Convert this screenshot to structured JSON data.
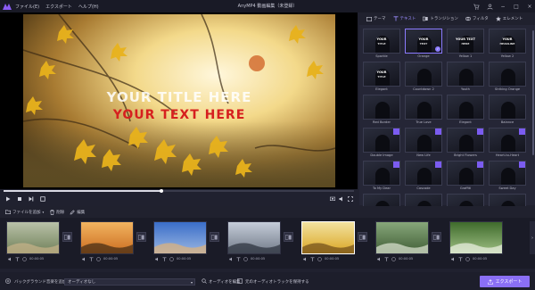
{
  "app": {
    "title": "AnyMP4 動画編集（未登録）",
    "menu": [
      "ファイル(E)",
      "エクスポート",
      "ヘルプ(H)"
    ],
    "accent_color": "#8b7bff"
  },
  "window_controls": {
    "cart": "cart-icon",
    "user": "user-icon",
    "minimize": "−",
    "maximize": "□",
    "close": "×"
  },
  "preview": {
    "title_line1": "YOUR TITLE HERE",
    "title_line2": "YOUR TEXT HERE",
    "progress": 0.45,
    "timecode": "00:00:13.20/00:00:45.95"
  },
  "panel": {
    "tabs": [
      {
        "label": "テーマ",
        "icon": "theme-icon"
      },
      {
        "label": "テキスト",
        "icon": "text-icon"
      },
      {
        "label": "トランジション",
        "icon": "transition-icon"
      },
      {
        "label": "フィルタ",
        "icon": "filter-icon"
      },
      {
        "label": "エレメント",
        "icon": "element-icon"
      }
    ],
    "active_tab": 1,
    "titles": [
      {
        "label": "Sparkle",
        "line1": "YOUR",
        "line2": "TITLE",
        "badge": false
      },
      {
        "label": "Orange",
        "line1": "YOUR",
        "line2": "TEXT",
        "badge": false,
        "selected": true
      },
      {
        "label": "Yellow 1",
        "line1": "YOUR TEXT",
        "line2": "HERE",
        "badge": false
      },
      {
        "label": "Yellow 2",
        "line1": "YOUR",
        "line2": "HEADLINE",
        "badge": false
      },
      {
        "label": "Elegant",
        "line1": "YOUR",
        "line2": "TITLE",
        "badge": false
      },
      {
        "label": "Countdown 2",
        "line1": "",
        "line2": "",
        "badge": false
      },
      {
        "label": "Youth",
        "line1": "",
        "line2": "",
        "badge": false
      },
      {
        "label": "Striking Orange",
        "line1": "",
        "line2": "",
        "badge": false
      },
      {
        "label": "Red Border",
        "line1": "",
        "line2": "",
        "badge": false
      },
      {
        "label": "True Love",
        "line1": "",
        "line2": "",
        "badge": false
      },
      {
        "label": "Elegant",
        "line1": "",
        "line2": "",
        "badge": false
      },
      {
        "label": "Balance",
        "line1": "",
        "line2": "",
        "badge": false
      },
      {
        "label": "Double Image",
        "line1": "",
        "line2": "",
        "badge": true
      },
      {
        "label": "New Life",
        "line1": "",
        "line2": "",
        "badge": true
      },
      {
        "label": "Bright Flowers",
        "line1": "",
        "line2": "",
        "badge": true
      },
      {
        "label": "Heart-to-Heart",
        "line1": "",
        "line2": "",
        "badge": true
      },
      {
        "label": "To My Dear",
        "line1": "",
        "line2": "",
        "badge": true
      },
      {
        "label": "Cascade",
        "line1": "",
        "line2": "",
        "badge": true
      },
      {
        "label": "Graffiti",
        "line1": "",
        "line2": "",
        "badge": true
      },
      {
        "label": "Sweet Day",
        "line1": "",
        "line2": "",
        "badge": true
      },
      {
        "label": "",
        "line1": "",
        "line2": "",
        "badge": false
      },
      {
        "label": "",
        "line1": "",
        "line2": "",
        "badge": false
      },
      {
        "label": "",
        "line1": "",
        "line2": "",
        "badge": false
      },
      {
        "label": "",
        "line1": "",
        "line2": "",
        "badge": false
      }
    ]
  },
  "toolbar": {
    "add_file": "ファイルを追加",
    "delete": "削除",
    "edit": "編集"
  },
  "timeline": {
    "clips": [
      {
        "duration": "00:00:05",
        "scene": "road"
      },
      {
        "duration": "00:00:05",
        "scene": "sunset-field"
      },
      {
        "duration": "00:00:05",
        "scene": "sky"
      },
      {
        "duration": "00:00:05",
        "scene": "mountain"
      },
      {
        "duration": "00:00:05",
        "scene": "leaves",
        "selected": true
      },
      {
        "duration": "00:00:05",
        "scene": "flower"
      },
      {
        "duration": "00:00:05",
        "scene": "tree"
      }
    ]
  },
  "bottom": {
    "bg_music_label": "バックグラウンド音楽を追加：",
    "bg_music_value": "オーディオなし",
    "audio_edit": "オーディオを編集",
    "keep_original": "元のオーディオトラックを保持する",
    "export": "エクスポート"
  }
}
